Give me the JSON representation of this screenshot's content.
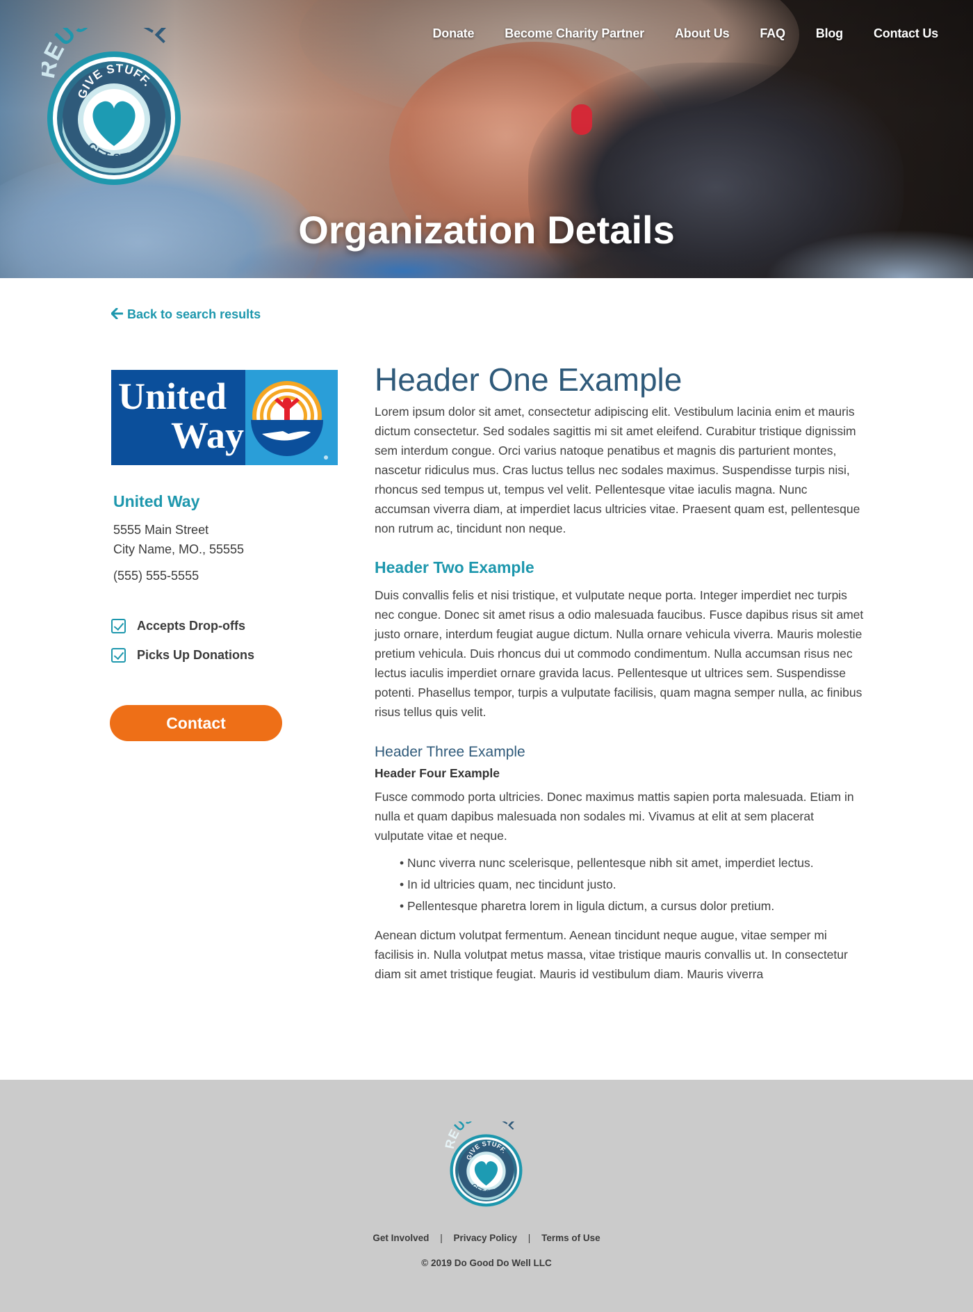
{
  "nav": {
    "items": [
      "Donate",
      "Become Charity Partner",
      "About Us",
      "FAQ",
      "Blog",
      "Contact Us"
    ]
  },
  "logo": {
    "brand_re": "RE",
    "brand_use": "USE",
    "brand_full": "FULL",
    "top_text": "GIVE STUFF.",
    "bottom_text": "GET STUFF."
  },
  "hero": {
    "title": "Organization Details"
  },
  "back_link": {
    "label": "Back to search results",
    "icon": "arrow-left-icon"
  },
  "organization": {
    "logo_text_line1": "United",
    "logo_text_line2": "Way",
    "name": "United Way",
    "address_line1": "5555 Main Street",
    "address_line2": "City Name, MO., 55555",
    "phone": "(555) 555-5555",
    "features": [
      "Accepts Drop-offs",
      "Picks Up Donations"
    ],
    "contact_button": "Contact"
  },
  "content": {
    "h1": "Header One Example",
    "p1": "Lorem ipsum dolor sit amet, consectetur adipiscing elit. Vestibulum lacinia enim et mauris dictum consectetur. Sed sodales sagittis mi sit amet eleifend. Curabitur tristique dignissim sem interdum congue. Orci varius natoque penatibus et magnis dis parturient montes, nascetur ridiculus mus. Cras luctus tellus nec sodales maximus. Suspendisse turpis nisi, rhoncus sed tempus ut, tempus vel velit. Pellentesque vitae iaculis magna. Nunc accumsan viverra diam, at imperdiet lacus ultricies vitae. Praesent quam est, pellentesque non rutrum ac, tincidunt non neque.",
    "h2": "Header Two Example",
    "p2": "Duis convallis felis et nisi tristique, et vulputate neque porta. Integer imperdiet nec turpis nec congue. Donec sit amet risus a odio malesuada faucibus. Fusce dapibus risus sit amet justo ornare, interdum feugiat augue dictum. Nulla ornare vehicula viverra. Mauris molestie pretium vehicula. Duis rhoncus dui ut commodo condimentum. Nulla accumsan risus nec lectus iaculis imperdiet ornare gravida lacus. Pellentesque ut ultrices sem. Suspendisse potenti. Phasellus tempor, turpis a vulputate facilisis, quam magna semper nulla, ac finibus risus tellus quis velit.",
    "h3": "Header Three Example",
    "h4": "Header Four Example",
    "p3": "Fusce commodo porta ultricies. Donec maximus mattis sapien porta malesuada. Etiam in nulla et quam dapibus malesuada non sodales mi. Vivamus at elit at sem placerat vulputate vitae et neque.",
    "list": [
      "Nunc viverra nunc scelerisque, pellentesque nibh sit amet, imperdiet lectus.",
      "In id ultricies quam, nec tincidunt justo.",
      "Pellentesque pharetra lorem in ligula dictum, a cursus dolor pretium."
    ],
    "p4": "Aenean dictum volutpat fermentum. Aenean tincidunt neque augue, vitae semper mi facilisis in. Nulla volutpat metus massa, vitae tristique mauris convallis ut. In consectetur diam sit amet tristique feugiat. Mauris id vestibulum diam. Mauris viverra"
  },
  "footer": {
    "links": [
      "Get Involved",
      "Privacy Policy",
      "Terms of Use"
    ],
    "separator": "|",
    "copyright": "© 2019 Do Good Do Well LLC"
  },
  "colors": {
    "teal": "#1d97ad",
    "navy_heading": "#2f5a7a",
    "orange_button": "#ee6f17",
    "footer_bg": "#cbcbcb",
    "united_way_blue": "#0b4f9b"
  }
}
